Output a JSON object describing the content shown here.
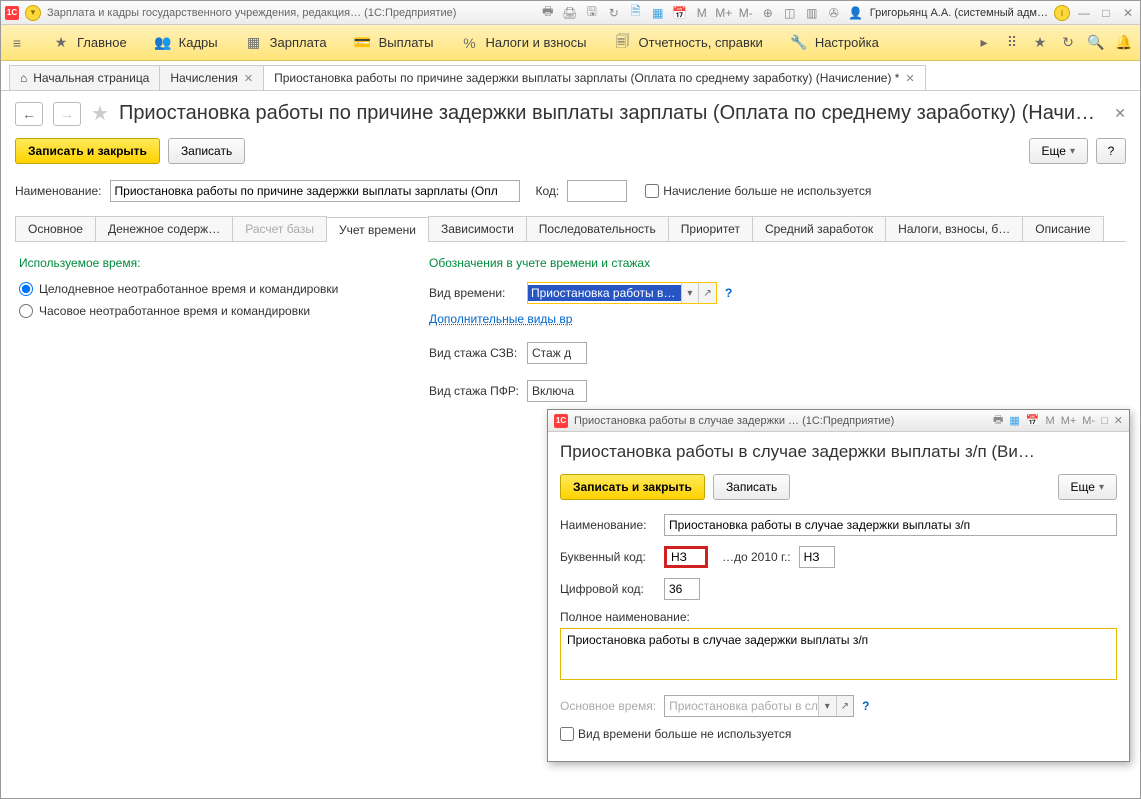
{
  "titlebar": {
    "app_title": "Зарплата и кадры государственного учреждения, редакция…  (1С:Предприятие)",
    "user": "Григорьянц А.А. (системный адм…"
  },
  "main_menu": {
    "items": [
      {
        "label": "Главное"
      },
      {
        "label": "Кадры"
      },
      {
        "label": "Зарплата"
      },
      {
        "label": "Выплаты"
      },
      {
        "label": "Налоги и взносы"
      },
      {
        "label": "Отчетность, справки"
      },
      {
        "label": "Настройка"
      }
    ]
  },
  "doc_tabs": {
    "items": [
      {
        "label": "Начальная страница",
        "has_close": false,
        "has_home": true
      },
      {
        "label": "Начисления",
        "has_close": true,
        "has_home": false
      },
      {
        "label": "Приостановка работы по причине задержки выплаты зарплаты (Оплата по среднему заработку) (Начисление) *",
        "has_close": true,
        "has_home": false,
        "active": true
      }
    ]
  },
  "page": {
    "title": "Приостановка работы по причине задержки выплаты зарплаты (Оплата по среднему заработку) (Начислени…",
    "actions": {
      "save_close": "Записать и закрыть",
      "save": "Записать",
      "more": "Еще",
      "help": "?"
    },
    "form": {
      "name_lbl": "Наименование:",
      "name_val": "Приостановка работы по причине задержки выплаты зарплаты (Опл",
      "code_lbl": "Код:",
      "code_val": "",
      "not_used_lbl": "Начисление больше не используется"
    },
    "tabs": {
      "items": [
        {
          "label": "Основное"
        },
        {
          "label": "Денежное содерж…"
        },
        {
          "label": "Расчет базы",
          "disabled": true
        },
        {
          "label": "Учет времени",
          "active": true
        },
        {
          "label": "Зависимости"
        },
        {
          "label": "Последовательность"
        },
        {
          "label": "Приоритет"
        },
        {
          "label": "Средний заработок"
        },
        {
          "label": "Налоги, взносы, б…"
        },
        {
          "label": "Описание"
        }
      ]
    },
    "time_tab": {
      "used_time_lbl": "Используемое время:",
      "radio1": "Целодневное неотработанное время и командировки",
      "radio2": "Часовое неотработанное время и командировки",
      "designation_lbl": "Обозначения в учете времени и стажах",
      "vid_vremeni_lbl": "Вид времени:",
      "vid_vremeni_val": "Приостановка работы в сл",
      "add_types_link": "Дополнительные виды вр",
      "szv_lbl": "Вид стажа СЗВ:",
      "szv_val": "Стаж д",
      "pfr_lbl": "Вид стажа ПФР:",
      "pfr_val": "Включа"
    }
  },
  "modal": {
    "window_title": "Приостановка работы в случае задержки …  (1С:Предприятие)",
    "heading": "Приостановка работы в случае задержки выплаты з/п (Ви…",
    "actions": {
      "save_close": "Записать и закрыть",
      "save": "Записать",
      "more": "Еще"
    },
    "name_lbl": "Наименование:",
    "name_val": "Приостановка работы в случае задержки выплаты з/п",
    "letter_code_lbl": "Буквенный код:",
    "letter_code_val": "НЗ",
    "pre2010_lbl": "…до 2010 г.:",
    "pre2010_val": "НЗ",
    "digit_code_lbl": "Цифровой код:",
    "digit_code_val": "36",
    "full_name_lbl": "Полное наименование:",
    "full_name_val": "Приостановка работы в случае задержки выплаты з/п",
    "main_time_lbl": "Основное время:",
    "main_time_val": "Приостановка работы в сл",
    "not_used_lbl": "Вид времени больше не используется"
  }
}
